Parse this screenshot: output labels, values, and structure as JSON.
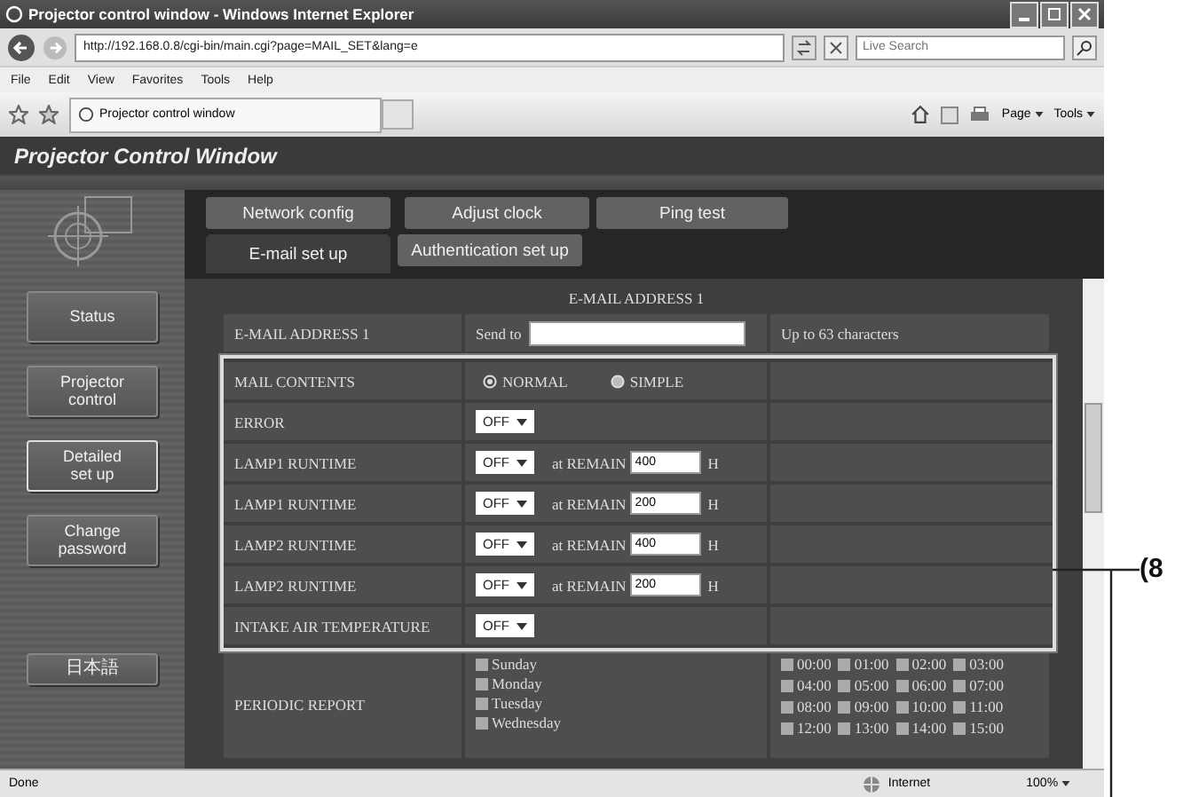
{
  "window": {
    "title": "Projector control window - Windows Internet Explorer"
  },
  "address_bar": {
    "url": "http://192.168.0.8/cgi-bin/main.cgi?page=MAIL_SET&lang=e",
    "search_placeholder": "Live Search"
  },
  "menu": [
    "File",
    "Edit",
    "View",
    "Favorites",
    "Tools",
    "Help"
  ],
  "browser_tab": {
    "label": "Projector control window"
  },
  "command_bar": [
    "Page",
    "Tools"
  ],
  "page_header": "Projector Control Window",
  "sidebar": {
    "items": [
      {
        "label": "Status",
        "selected": false
      },
      {
        "label": "Projector control",
        "selected": false
      },
      {
        "label": "Detailed set up",
        "selected": true
      },
      {
        "label": "Change password",
        "selected": false
      },
      {
        "label": "日本語",
        "selected": false
      }
    ]
  },
  "tabs": [
    [
      {
        "label": "Network config",
        "selected": false
      },
      {
        "label": "Adjust clock",
        "selected": false
      },
      {
        "label": "Ping test",
        "selected": false
      }
    ],
    [
      {
        "label": "E-mail set up",
        "selected": true
      },
      {
        "label": "Authentication set up",
        "selected": false
      }
    ]
  ],
  "section_title": "E-MAIL ADDRESS 1",
  "address_row": {
    "label": "E-MAIL ADDRESS 1",
    "prefix": "Send to",
    "note": "Up to 63 characters"
  },
  "rows": [
    {
      "kind": "radio",
      "label": "MAIL CONTENTS",
      "options": [
        {
          "label": "NORMAL",
          "selected": true
        },
        {
          "label": "SIMPLE",
          "selected": false
        }
      ]
    },
    {
      "kind": "select",
      "label": "ERROR",
      "value": "OFF"
    },
    {
      "kind": "remain",
      "label": "LAMP1 RUNTIME",
      "value": "OFF",
      "prefix": "at REMAIN",
      "hours": "400",
      "unit": "H"
    },
    {
      "kind": "remain",
      "label": "LAMP1 RUNTIME",
      "value": "OFF",
      "prefix": "at REMAIN",
      "hours": "200",
      "unit": "H"
    },
    {
      "kind": "remain",
      "label": "LAMP2 RUNTIME",
      "value": "OFF",
      "prefix": "at REMAIN",
      "hours": "400",
      "unit": "H"
    },
    {
      "kind": "remain",
      "label": "LAMP2 RUNTIME",
      "value": "OFF",
      "prefix": "at REMAIN",
      "hours": "200",
      "unit": "H"
    },
    {
      "kind": "select",
      "label": "INTAKE AIR TEMPERATURE",
      "value": "OFF"
    }
  ],
  "periodic_report": {
    "label": "PERIODIC REPORT",
    "days": [
      {
        "label": "Sunday",
        "checked": false
      },
      {
        "label": "Monday",
        "checked": false
      },
      {
        "label": "Tuesday",
        "checked": false
      },
      {
        "label": "Wednesday",
        "checked": false
      }
    ],
    "hours": [
      {
        "label": "00:00",
        "checked": false
      },
      {
        "label": "01:00",
        "checked": false
      },
      {
        "label": "02:00",
        "checked": false
      },
      {
        "label": "03:00",
        "checked": false
      },
      {
        "label": "04:00",
        "checked": false
      },
      {
        "label": "05:00",
        "checked": false
      },
      {
        "label": "06:00",
        "checked": false
      },
      {
        "label": "07:00",
        "checked": false
      },
      {
        "label": "08:00",
        "checked": false
      },
      {
        "label": "09:00",
        "checked": false
      },
      {
        "label": "10:00",
        "checked": false
      },
      {
        "label": "11:00",
        "checked": false
      },
      {
        "label": "12:00",
        "checked": false
      },
      {
        "label": "13:00",
        "checked": false
      },
      {
        "label": "14:00",
        "checked": false
      },
      {
        "label": "15:00",
        "checked": false
      }
    ]
  },
  "status_bar": {
    "text": "Done",
    "zone": "Internet",
    "zoom": "100%"
  },
  "callout": "(8"
}
